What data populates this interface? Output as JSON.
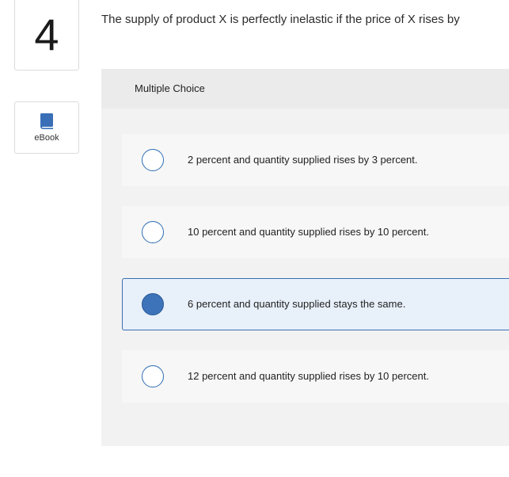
{
  "question": {
    "number": "4",
    "prompt": "The supply of product X is perfectly inelastic if the price of X rises by"
  },
  "sidebar": {
    "ebook_label": "eBook",
    "ebook_icon": "book-icon"
  },
  "answer_panel": {
    "title": "Multiple Choice",
    "options": [
      {
        "label": "2 percent and quantity supplied rises by 3 percent.",
        "selected": false
      },
      {
        "label": "10 percent and quantity supplied rises by 10 percent.",
        "selected": false
      },
      {
        "label": "6 percent and quantity supplied stays the same.",
        "selected": true
      },
      {
        "label": "12 percent and quantity supplied rises by 10 percent.",
        "selected": false
      }
    ]
  },
  "colors": {
    "accent": "#2e6db4",
    "selected_fill": "#3d73b9",
    "selected_background": "#e8f0fa",
    "panel_background": "#f2f2f2"
  }
}
